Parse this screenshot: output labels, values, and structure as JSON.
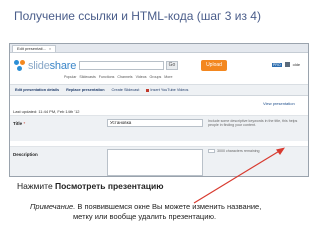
{
  "slide": {
    "title": "Получение ссылки и HTML-кода (шаг 3 из 4)",
    "instruction_prefix": "Нажмите",
    "instruction_action": "Посмотреть презентацию",
    "note_label": "Примечание.",
    "note_line1": "В появившемся окне Вы можете изменить название,",
    "note_line2": "метку или вообще удалить презентацию."
  },
  "screenshot": {
    "browser_tab": "Edit presentati...",
    "logo_word_light": "slide",
    "logo_word_bold": "share",
    "search_button": "Go",
    "upload_button": "Upload",
    "badge": "PRO",
    "user": "olde",
    "nav": [
      "Popular",
      "Slidecasts",
      "Functions",
      "Channels",
      "Videos",
      "Groups",
      "More"
    ],
    "actions": [
      "Edit presentation details",
      "Replace presentation",
      "Create Slidecast",
      "Insert YouTube Videos"
    ],
    "view_link": "View presentation",
    "last_updated": "Last updated: 11:44 PM, Feb 14th '12",
    "title_label": "Title",
    "required_mark": "*",
    "title_value": "Установка",
    "title_hint": "Include some descriptive keywords in the title, this helps people in finding your content.",
    "description_label": "Description",
    "char_counter": "3000 characters remaining"
  },
  "colors": {
    "title_text": "#4a5d8a",
    "upload_orange": "#f3871f",
    "arrow_red": "#d83a2f",
    "link_blue": "#1f4f8c"
  }
}
